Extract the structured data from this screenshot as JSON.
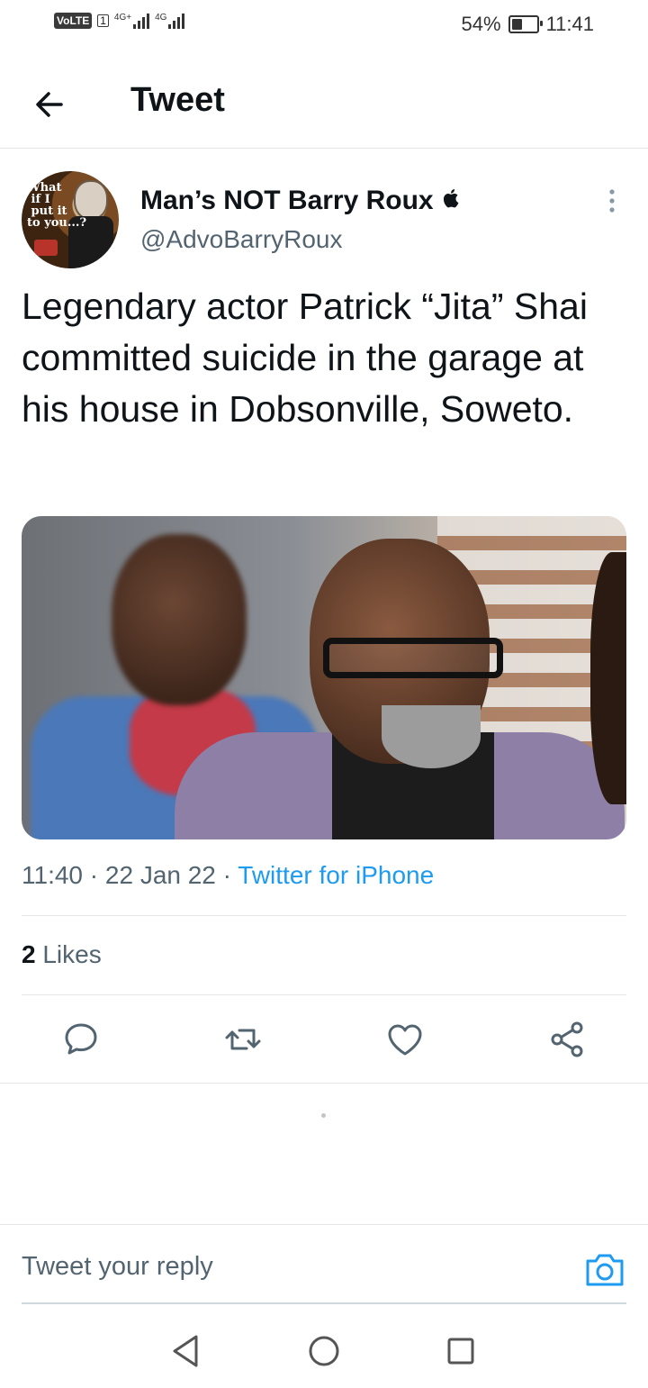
{
  "status_bar": {
    "volte": "VoLTE",
    "sim": "1",
    "net1": "4G+",
    "net2": "4G",
    "battery_percent_text": "54%",
    "battery_level": 0.54,
    "time": "11:41"
  },
  "header": {
    "back_icon": "arrow-left-icon",
    "title": "Tweet"
  },
  "tweet": {
    "display_name": "Man’s NOT Barry Roux",
    "badge_icon": "apple-icon",
    "handle": "@AdvoBarryRoux",
    "avatar_text": "What if I put it to you...?",
    "text": "Legendary actor Patrick “Jita” Shai committed suicide in the garage at his house in Dobsonville, Soweto.",
    "time": "11:40",
    "date": "22 Jan 22",
    "separator": "·",
    "source": "Twitter for iPhone",
    "likes_count": "2",
    "likes_label": "Likes"
  },
  "actions": [
    {
      "name": "reply-icon"
    },
    {
      "name": "retweet-icon"
    },
    {
      "name": "like-icon"
    },
    {
      "name": "share-icon"
    }
  ],
  "reply_bar": {
    "placeholder": "Tweet your reply",
    "camera_icon": "camera-icon"
  },
  "colors": {
    "accent": "#1d9bf0",
    "text": "#0f1419",
    "muted": "#536471"
  }
}
